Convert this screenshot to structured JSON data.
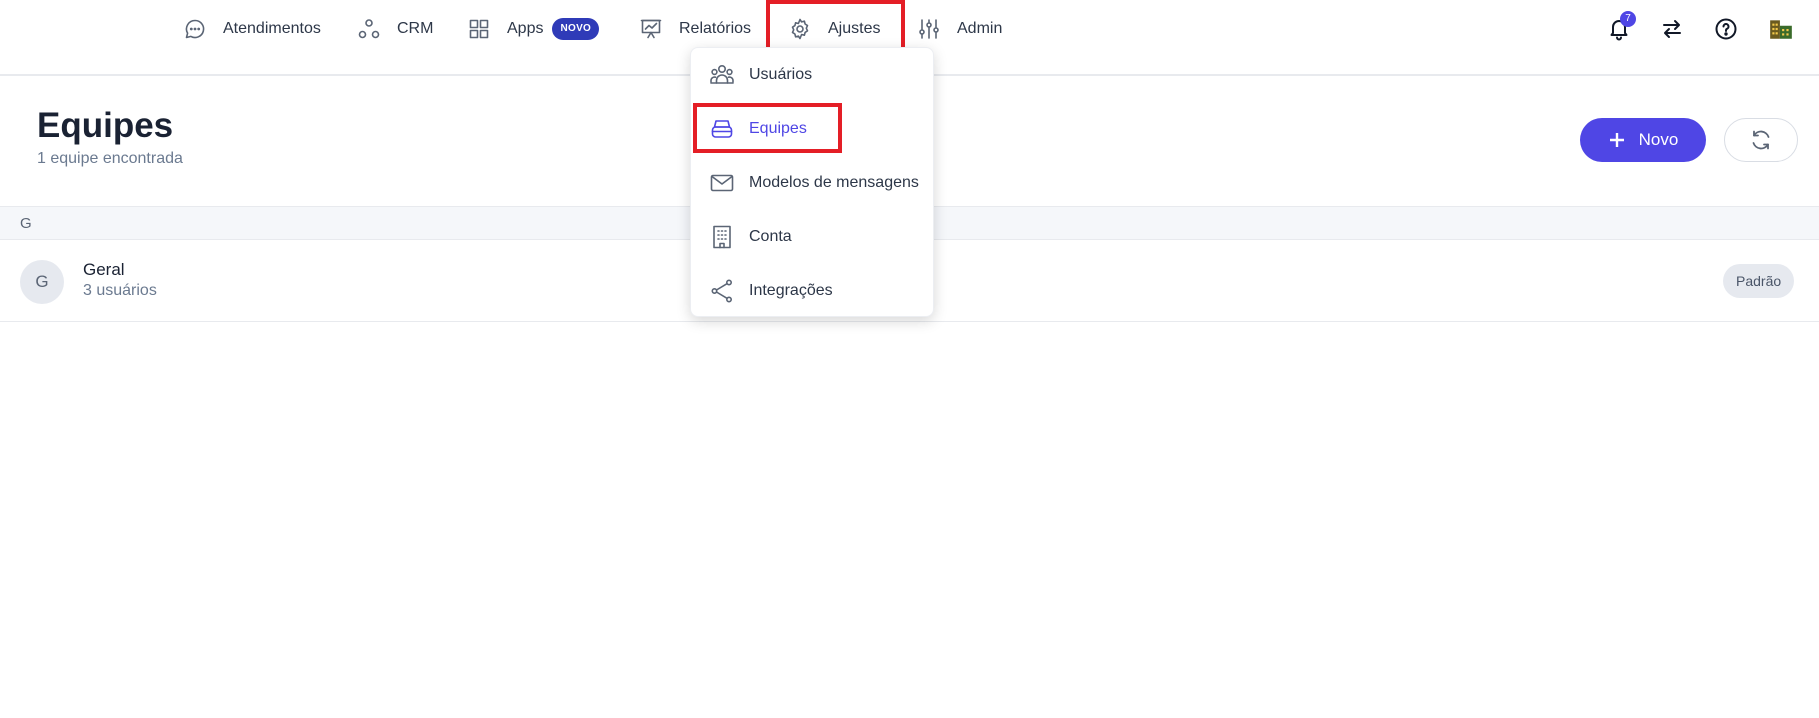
{
  "nav": {
    "items": [
      {
        "label": "Atendimentos",
        "icon": "chat-bubble-icon"
      },
      {
        "label": "CRM",
        "icon": "crm-circles-icon"
      },
      {
        "label": "Apps",
        "icon": "grid-apps-icon",
        "badge": "NOVO"
      },
      {
        "label": "Relatórios",
        "icon": "presentation-chart-icon"
      },
      {
        "label": "Ajustes",
        "icon": "gear-icon"
      },
      {
        "label": "Admin",
        "icon": "sliders-icon"
      }
    ],
    "notifications_count": "7"
  },
  "settings_menu": {
    "items": [
      {
        "label": "Usuários",
        "icon": "users-icon"
      },
      {
        "label": "Equipes",
        "icon": "team-stack-icon",
        "active": true
      },
      {
        "label": "Modelos de mensagens",
        "icon": "envelope-icon"
      },
      {
        "label": "Conta",
        "icon": "building-icon"
      },
      {
        "label": "Integrações",
        "icon": "share-icon"
      }
    ]
  },
  "page": {
    "title": "Equipes",
    "subtitle": "1 equipe encontrada",
    "new_button": "Novo"
  },
  "list": {
    "group_letter": "G",
    "rows": [
      {
        "avatar": "G",
        "name": "Geral",
        "users": "3 usuários",
        "badge": "Padrão"
      }
    ]
  },
  "colors": {
    "accent": "#4f46e5",
    "highlight": "#e41e26",
    "novo_badge": "#2f3bb8"
  }
}
